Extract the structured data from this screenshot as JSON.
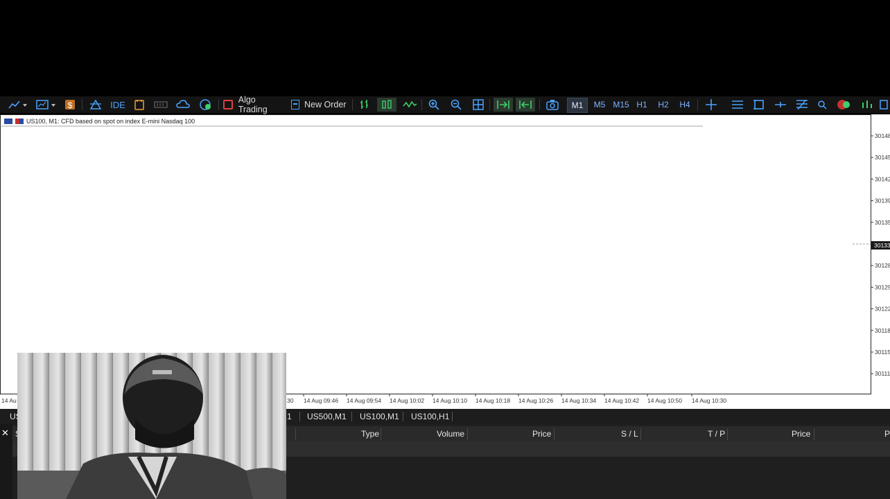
{
  "toolbar": {
    "algo_trading_label": "Algo Trading",
    "new_order_label": "New Order",
    "ide_label": "IDE",
    "timeframes": [
      "M1",
      "M5",
      "M15",
      "H1",
      "H2",
      "H4"
    ],
    "active_timeframe": "M1"
  },
  "chart": {
    "title": "US100, M1:  CFD based on spot on index E-mini Nasdaq 100",
    "price_labels": [
      "30148",
      "30145",
      "30142",
      "30139",
      "30135",
      "30132",
      "30128",
      "30125",
      "30122",
      "30118",
      "30115",
      "30111"
    ],
    "current_price_label": "30133",
    "time_labels": [
      "14 Aug 09:30",
      "14 Aug 09:46",
      "14 Aug 09:54",
      "14 Aug 10:02",
      "14 Aug 10:10",
      "14 Aug 10:18",
      "14 Aug 10:26",
      "14 Aug 10:34",
      "14 Aug 10:42",
      "14 Aug 10:50",
      "14 Aug 10:30"
    ],
    "first_time_label": "14 Au",
    "colors": {
      "background": "#ffffff",
      "bull_candle": "#ffffff",
      "bear_candle": "#000000",
      "sar_dots": "#2ec4ef",
      "blue_line": "#5b7bd5",
      "orange_line": "#f0a070"
    }
  },
  "symbol_tabs": [
    "US",
    "1",
    "US500,M1",
    "US100,M1",
    "US100,H1"
  ],
  "trade_panel": {
    "close_glyph": "✕",
    "columns": [
      "S",
      "Type",
      "Volume",
      "Price",
      "S / L",
      "T / P",
      "Price",
      "P"
    ]
  },
  "icons": [
    "chart-type-icon",
    "dollar-icon",
    "indicator-icon",
    "ide-icon",
    "folder-icon",
    "signal-icon",
    "cloud-icon",
    "vps-icon",
    "algo-trading-icon",
    "new-order-icon",
    "candles-icon",
    "bars-icon",
    "line-icon",
    "zoom-in-icon",
    "zoom-out-icon",
    "grid-icon",
    "autoscroll-icon",
    "shift-icon",
    "screenshot-icon",
    "crosshair-icon",
    "equidistant-icon",
    "rectangle-icon",
    "hline-icon",
    "fibo-icon",
    "search-icon",
    "avatar-icon",
    "level-icon"
  ]
}
